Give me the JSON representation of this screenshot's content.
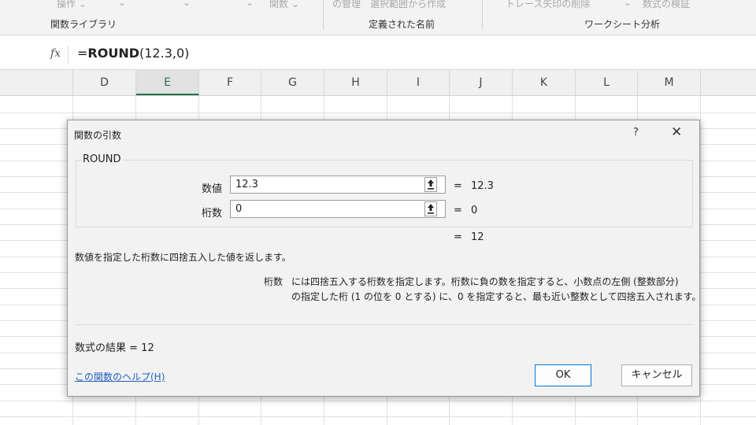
{
  "ribbon": {
    "top_items": [
      "操作 ⌄",
      "⌄",
      "⌄",
      "⌄",
      "関数 ⌄",
      "の管理",
      "選択範囲から作成",
      "トレース矢印の削除",
      "⌄",
      "数式の検証"
    ],
    "groups": {
      "function_library": "関数ライブラリ",
      "defined_names": "定義された名前",
      "formula_auditing": "ワークシート分析"
    }
  },
  "formula_bar": {
    "fx": "fx",
    "formula_prefix": "=",
    "formula_func": "ROUND",
    "formula_args": "(12.3,0)"
  },
  "columns": [
    "D",
    "E",
    "F",
    "G",
    "H",
    "I",
    "J",
    "K",
    "L",
    "M"
  ],
  "selected_column": "E",
  "dialog": {
    "title": "関数の引数",
    "help": "?",
    "close": "✕",
    "function_name": "ROUND",
    "args": [
      {
        "label": "数値",
        "value": "12.3",
        "result": "12.3"
      },
      {
        "label": "桁数",
        "value": "0",
        "result": "0"
      }
    ],
    "equals": "=",
    "overall_result": "12",
    "description": "数値を指定した桁数に四捨五入した値を返します。",
    "arg_desc_name": "桁数",
    "arg_desc_line1": "には四捨五入する桁数を指定します。桁数に負の数を指定すると、小数点の左側 (整数部分)",
    "arg_desc_line2": "の指定した桁 (1 の位を 0 とする) に、0 を指定すると、最も近い整数として四捨五入されます。",
    "formula_result_label": "数式の結果 =",
    "formula_result_value": "12",
    "help_link": "この関数のヘルプ(H)",
    "ok_label": "OK",
    "cancel_label": "キャンセル"
  },
  "colors": {
    "excel_green": "#217346",
    "link_blue": "#1f5fbf",
    "ok_border": "#0078d7"
  }
}
